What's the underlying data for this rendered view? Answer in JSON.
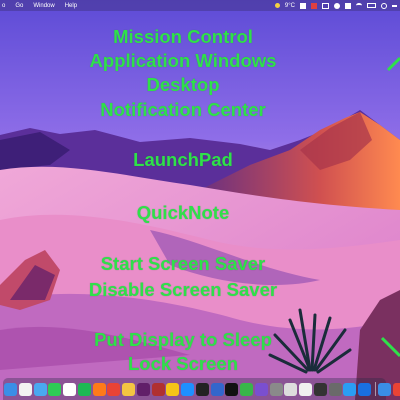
{
  "menubar": {
    "menus": [
      "o",
      "Go",
      "Window",
      "Help"
    ],
    "status": {
      "temperature": "9°C"
    }
  },
  "labels": {
    "mission_control": "Mission Control",
    "application_windows": "Application Windows",
    "desktop": "Desktop",
    "notification_center": "Notification Center",
    "launchpad": "LaunchPad",
    "quicknote": "QuickNote",
    "start_screen_saver": "Start Screen Saver",
    "disable_screen_saver": "Disable Screen Saver",
    "put_display_to_sleep": "Put Display to Sleep",
    "lock_screen": "Lock Screen"
  },
  "colors": {
    "label_green": "#2fe04a"
  },
  "dock": {
    "apps": [
      {
        "name": "finder-icon",
        "color": "#3a8ee6"
      },
      {
        "name": "reminders-icon",
        "color": "#f2f2f2"
      },
      {
        "name": "mail-icon",
        "color": "#4aa8f0"
      },
      {
        "name": "messages-icon",
        "color": "#2ecc55"
      },
      {
        "name": "calendar-icon",
        "color": "#ffffff"
      },
      {
        "name": "spotify-icon",
        "color": "#1db954"
      },
      {
        "name": "firefox-icon",
        "color": "#ff7a1a"
      },
      {
        "name": "chrome-icon",
        "color": "#e94335"
      },
      {
        "name": "photos-icon",
        "color": "#f4c542"
      },
      {
        "name": "slack-icon",
        "color": "#611f69"
      },
      {
        "name": "tes-icon",
        "color": "#b03030"
      },
      {
        "name": "butterfly-icon",
        "color": "#f5c518"
      },
      {
        "name": "app-store-icon",
        "color": "#1e90ff"
      },
      {
        "name": "obs-icon",
        "color": "#222222"
      },
      {
        "name": "dot-app-icon",
        "color": "#3366cc"
      },
      {
        "name": "terminal-icon",
        "color": "#111111"
      },
      {
        "name": "green-app-icon",
        "color": "#39b54a"
      },
      {
        "name": "grid-app-icon",
        "color": "#7a4fd0"
      },
      {
        "name": "settings-icon",
        "color": "#8a8a8a"
      },
      {
        "name": "textedit-icon",
        "color": "#dddddd"
      },
      {
        "name": "qr-app-icon",
        "color": "#f0f0f0"
      },
      {
        "name": "dark-app-icon",
        "color": "#333333"
      },
      {
        "name": "media-app-icon",
        "color": "#6a6a6a"
      },
      {
        "name": "safari-icon",
        "color": "#2a9df4"
      },
      {
        "name": "xcode-icon",
        "color": "#1a6fe0"
      }
    ],
    "extras": [
      {
        "name": "scissors-icon",
        "color": "#3a8ee6"
      },
      {
        "name": "gmail-icon",
        "color": "#e94335"
      },
      {
        "name": "appstore-blue-icon",
        "color": "#2b7bea"
      },
      {
        "name": "facetime-icon",
        "color": "#2ecc55"
      },
      {
        "name": "trash-icon",
        "color": "#c8c8d0"
      }
    ]
  }
}
